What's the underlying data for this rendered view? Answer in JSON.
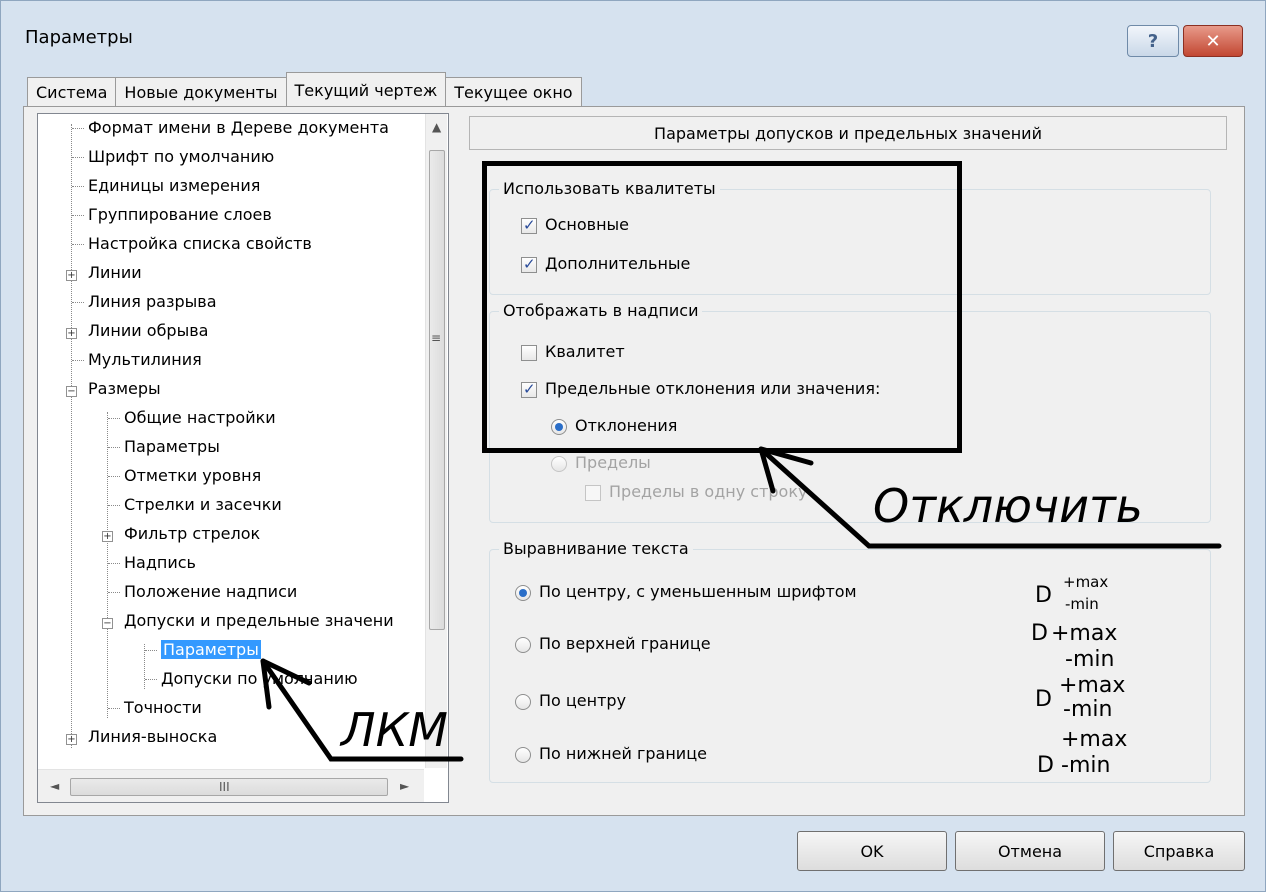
{
  "window": {
    "title": "Параметры",
    "help_glyph": "?",
    "close_glyph": "✕"
  },
  "tabs": [
    {
      "label": "Система"
    },
    {
      "label": "Новые документы"
    },
    {
      "label": "Текущий чертеж"
    },
    {
      "label": "Текущее окно"
    }
  ],
  "tree": {
    "items": [
      {
        "label": "Формат имени в Дереве документа"
      },
      {
        "label": "Шрифт по умолчанию"
      },
      {
        "label": "Единицы измерения"
      },
      {
        "label": "Группирование слоев"
      },
      {
        "label": "Настройка списка свойств"
      },
      {
        "label": "Линии"
      },
      {
        "label": "Линия разрыва"
      },
      {
        "label": "Линии обрыва"
      },
      {
        "label": "Мультилиния"
      },
      {
        "label": "Размеры"
      },
      {
        "label": "Общие настройки"
      },
      {
        "label": "Параметры"
      },
      {
        "label": "Отметки уровня"
      },
      {
        "label": "Стрелки и засечки"
      },
      {
        "label": "Фильтр стрелок"
      },
      {
        "label": "Надпись"
      },
      {
        "label": "Положение надписи"
      },
      {
        "label": "Допуски и предельные значени"
      },
      {
        "label": "Параметры"
      },
      {
        "label": "Допуски по умолчанию"
      },
      {
        "label": "Точности"
      },
      {
        "label": "Линия-выноска"
      }
    ]
  },
  "panel": {
    "header": "Параметры допусков и предельных значений",
    "group_qualitets": {
      "title": "Использовать квалитеты",
      "main": "Основные",
      "additional": "Дополнительные"
    },
    "group_display": {
      "title": "Отображать в надписи",
      "qualitet": "Квалитет",
      "limits_deviations": "Предельные отклонения или значения:",
      "deviations": "Отклонения",
      "limits": "Пределы",
      "one_line": "Пределы в одну строку"
    },
    "group_align": {
      "title": "Выравнивание текста",
      "opt_center_small": "По центру, с уменьшенным шрифтом",
      "opt_top": "По верхней границе",
      "opt_center": "По центру",
      "opt_bottom": "По нижней границе",
      "fmt_D": "D",
      "fmt_max": "+max",
      "fmt_min": "-min"
    }
  },
  "buttons": {
    "ok": "OK",
    "cancel": "Отмена",
    "help": "Справка"
  },
  "annotations": {
    "disable": "Отключить",
    "lkm": "ЛКМ"
  },
  "scroll": {
    "up": "▲",
    "left": "◄",
    "right": "►",
    "grip_v": "≡",
    "grip_h": "III"
  }
}
